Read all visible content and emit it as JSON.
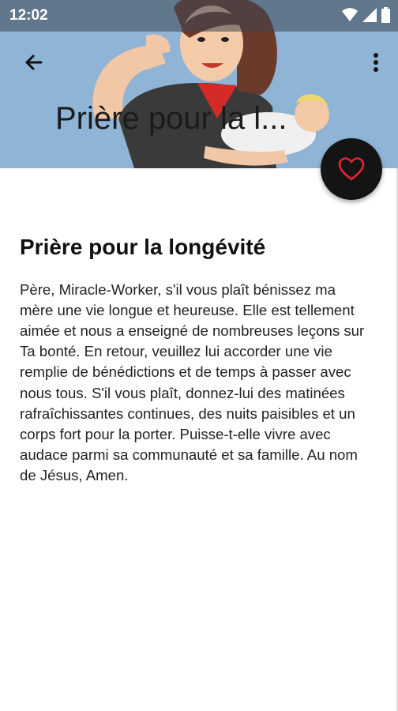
{
  "status_bar": {
    "time": "12:02",
    "icons": [
      "wifi-icon",
      "cellular-signal-icon",
      "battery-icon"
    ]
  },
  "app_bar": {
    "back_icon": "arrow-back-icon",
    "menu_icon": "more-vert-icon",
    "collapsed_title": "Prière pour la l..."
  },
  "fab": {
    "icon": "heart-outline-icon",
    "color": "#e0243b"
  },
  "article": {
    "title": "Prière pour la longévité",
    "body": "Père, Miracle-Worker, s'il vous plaît bénissez ma mère une vie longue et heureuse. Elle est tellement aimée et nous a enseigné de nombreuses leçons sur Ta bonté. En retour, veuillez lui accorder une vie remplie de bénédictions et de temps à passer avec nous tous. S'il vous plaît, donnez-lui des matinées rafraîchissantes continues, des nuits paisibles et un corps fort pour la porter. Puisse-t-elle vivre avec audace parmi sa communauté et sa famille. Au nom de Jésus, Amen."
  },
  "colors": {
    "header_background": "#8fb4d6",
    "accent_red": "#d42a2a",
    "fab_background": "#141414"
  }
}
